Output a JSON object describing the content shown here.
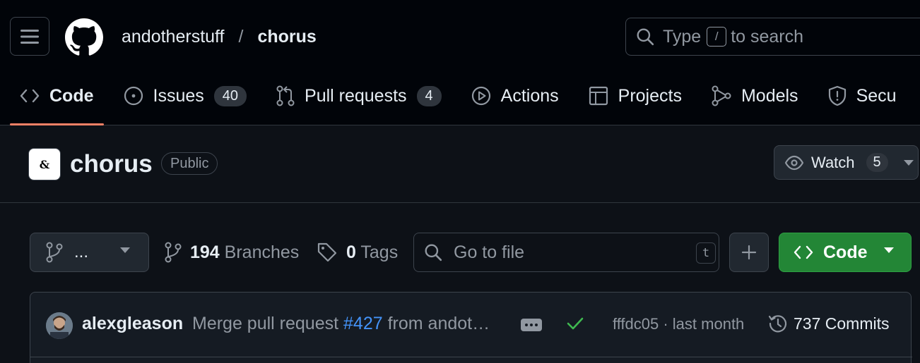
{
  "header": {
    "owner": "andotherstuff",
    "separator": "/",
    "repo": "chorus",
    "search_prefix": "Type",
    "search_key": "/",
    "search_suffix": "to search"
  },
  "tabs": [
    {
      "label": "Code",
      "icon": "code-icon"
    },
    {
      "label": "Issues",
      "count": "40",
      "icon": "issue-icon"
    },
    {
      "label": "Pull requests",
      "count": "4",
      "icon": "pull-request-icon"
    },
    {
      "label": "Actions",
      "icon": "play-icon"
    },
    {
      "label": "Projects",
      "icon": "table-icon"
    },
    {
      "label": "Models",
      "icon": "models-icon"
    },
    {
      "label": "Secu",
      "icon": "shield-icon"
    }
  ],
  "repo": {
    "name": "chorus",
    "visibility": "Public",
    "org_logo_text": "&",
    "watch_label": "Watch",
    "watch_count": "5"
  },
  "toolbar": {
    "branch_label": "...",
    "branches_count": "194",
    "branches_label": "Branches",
    "tags_count": "0",
    "tags_label": "Tags",
    "goto_placeholder": "Go to file",
    "goto_key": "t",
    "code_label": "Code"
  },
  "commit": {
    "author": "alexgleason",
    "message_prefix": "Merge pull request",
    "pr_number": "#427",
    "message_suffix": "from andot…",
    "sha_time": "fffdc05 · last month",
    "commits_label": "737 Commits"
  },
  "colors": {
    "accent_tab": "#f78166",
    "primary_button": "#238636",
    "link": "#4493f8",
    "success": "#3fb950"
  }
}
